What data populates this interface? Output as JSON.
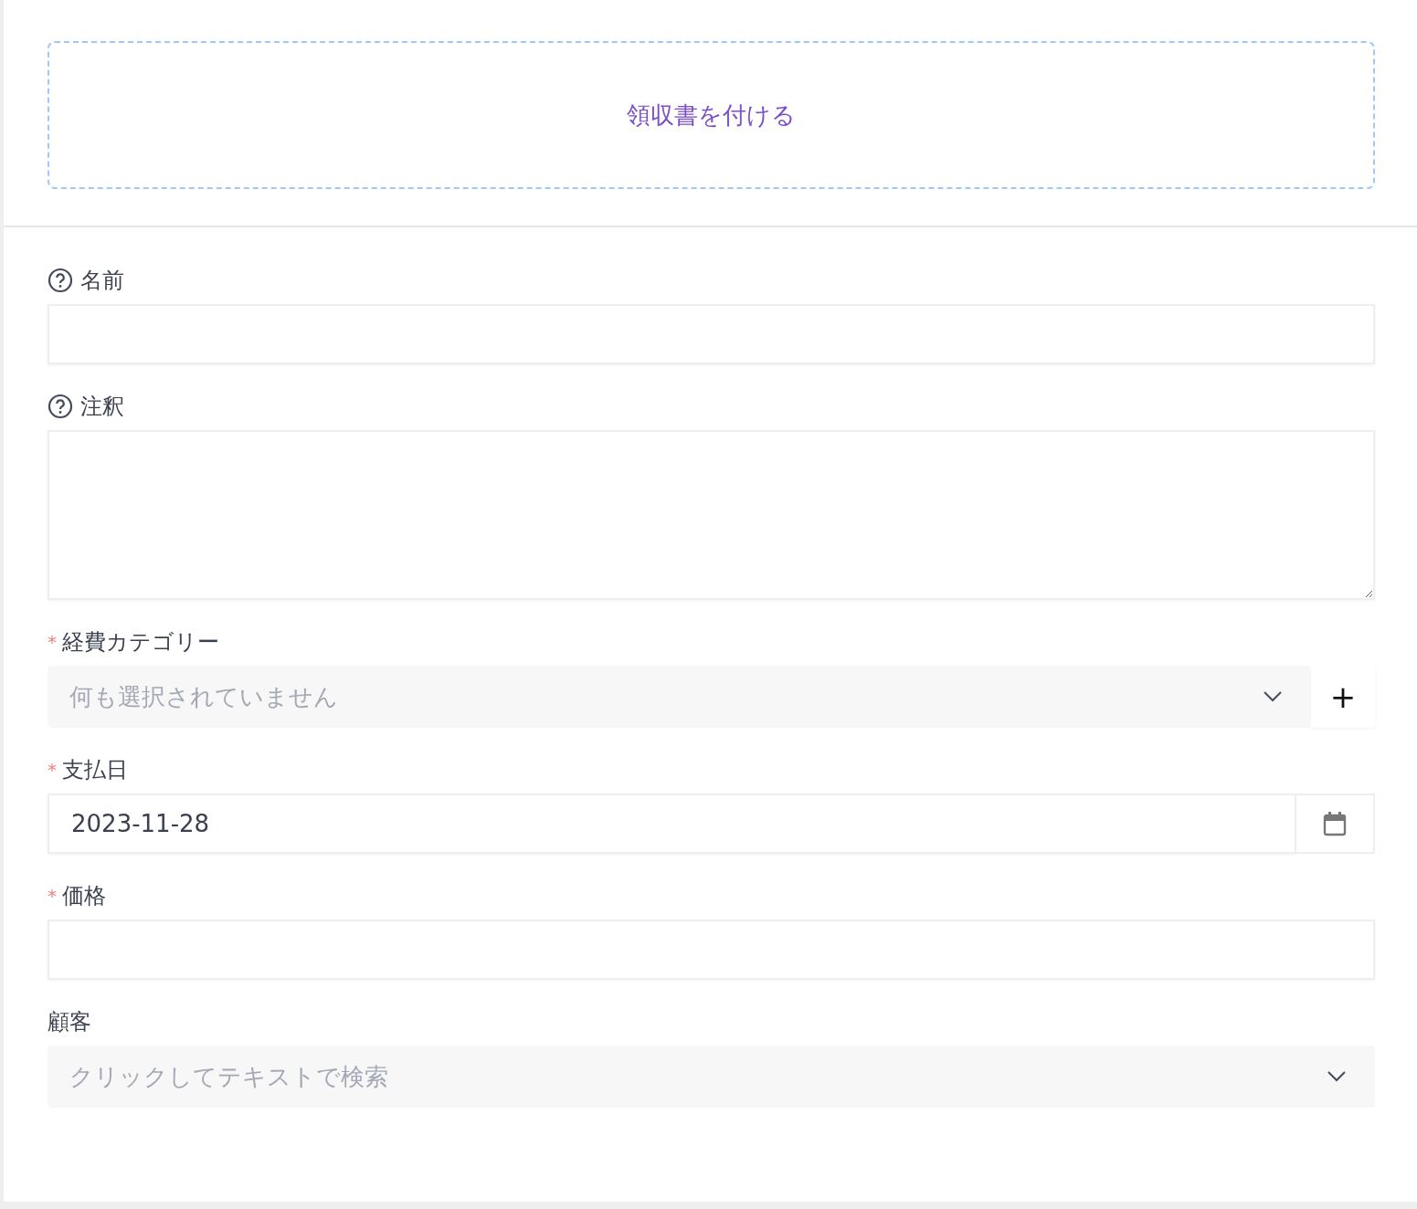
{
  "upload": {
    "label": "領収書を付ける"
  },
  "fields": [
    {
      "kind": "text",
      "label": "名前",
      "help": true
    },
    {
      "kind": "textarea",
      "label": "注釈",
      "help": true
    },
    {
      "kind": "select",
      "label": "経費カテゴリー",
      "help": false,
      "required_mark": "*",
      "placeholder": "何も選択されていません",
      "add_label": "+"
    },
    {
      "kind": "date",
      "label": "支払日",
      "help": false,
      "required_mark": "*",
      "value": "2023-11-28"
    },
    {
      "kind": "text",
      "label": "価格",
      "help": false,
      "required_mark": "*"
    },
    {
      "kind": "search",
      "label": "顧客",
      "help": false,
      "placeholder": "クリックしてテキストで検索"
    }
  ]
}
